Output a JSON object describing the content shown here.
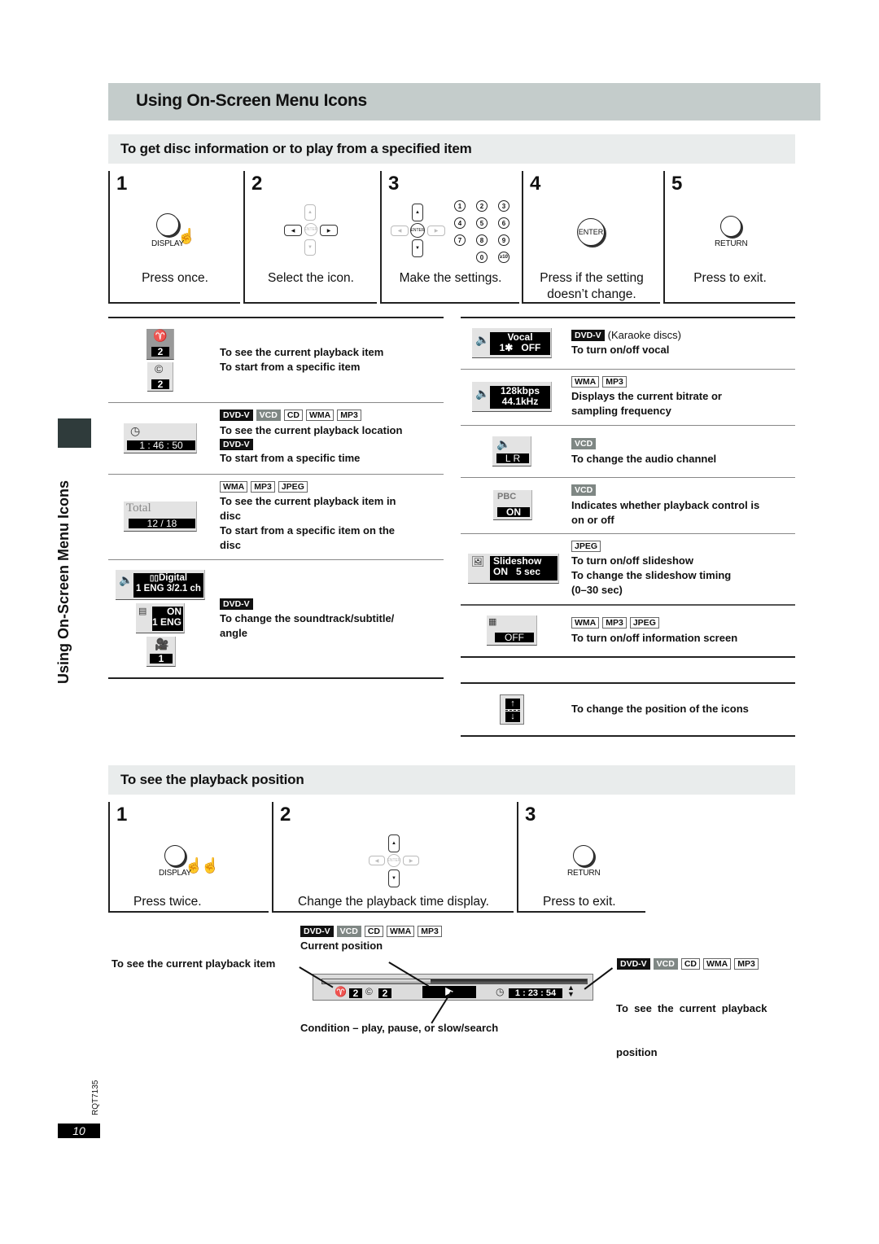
{
  "title": "Using On-Screen Menu Icons",
  "side_label": "Using On-Screen Menu Icons",
  "page_number": "10",
  "doc_code": "RQT7135",
  "section1": {
    "title": "To get disc information or to play from a specified item",
    "steps": [
      {
        "num": "1",
        "button": "DISPLAY",
        "caption": "Press once."
      },
      {
        "num": "2",
        "enter_label": "ENTER",
        "caption": "Select the icon."
      },
      {
        "num": "3",
        "enter_label": "ENTER",
        "caption": "Make the settings.",
        "num_keys": [
          "1",
          "2",
          "3",
          "4",
          "5",
          "6",
          "7",
          "8",
          "9",
          "0",
          "≥10"
        ]
      },
      {
        "num": "4",
        "button": "ENTER",
        "caption_line1": "Press if the setting",
        "caption_line2": "doesn’t change."
      },
      {
        "num": "5",
        "button": "RETURN",
        "caption": "Press to exit."
      }
    ]
  },
  "left_items": [
    {
      "icon": "title-chapter-icon",
      "osd_title_num": "2",
      "osd_chapter_num": "2",
      "badges": [],
      "lines": [
        "To see the current playback item",
        "To start from a specific item"
      ]
    },
    {
      "icon": "clock-icon",
      "osd_text": "1 : 46 : 50",
      "badges": [
        "DVD-V",
        "VCD",
        "CD",
        "WMA",
        "MP3"
      ],
      "line1": "To see the current playback location",
      "badges2": [
        "DVD-V"
      ],
      "line2": "To start from a specific time"
    },
    {
      "icon": "total-icon",
      "osd_label": "Total",
      "osd_text": "12 / 18",
      "badges": [
        "WMA",
        "MP3",
        "JPEG"
      ],
      "lines": [
        "To see the current playback item in",
        "disc",
        "To start from a specific item on the",
        "disc"
      ]
    },
    {
      "icon": "soundtrack-icon",
      "osd_audio_line1": "Digital",
      "osd_audio_line2": "1 ENG 3/2.1 ch",
      "osd_sub_line1": "ON",
      "osd_sub_line2": "1 ENG",
      "osd_angle": "1",
      "badges": [
        "DVD-V"
      ],
      "lines": [
        "To change the soundtrack/subtitle/",
        "angle"
      ]
    }
  ],
  "right_items": [
    {
      "icon": "vocal-icon",
      "osd_line1": "Vocal",
      "osd_line2": "1✱   OFF",
      "badges": [
        "DVD-V"
      ],
      "note": "(Karaoke discs)",
      "lines": [
        "To turn on/off vocal"
      ]
    },
    {
      "icon": "bitrate-icon",
      "osd_line1": "128kbps",
      "osd_line2": "44.1kHz",
      "badges": [
        "WMA",
        "MP3"
      ],
      "lines": [
        "Displays the current bitrate or",
        "sampling frequency"
      ]
    },
    {
      "icon": "audio-channel-icon",
      "osd_text": "L R",
      "badges": [
        "VCD"
      ],
      "lines": [
        "To change the audio channel"
      ]
    },
    {
      "icon": "pbc-icon",
      "osd_label": "PBC",
      "osd_text": "ON",
      "badges": [
        "VCD"
      ],
      "lines": [
        "Indicates whether playback control is",
        "on or off"
      ]
    },
    {
      "icon": "slideshow-icon",
      "osd_line1": "Slideshow",
      "osd_line2": "ON   5 sec",
      "badges": [
        "JPEG"
      ],
      "lines": [
        "To turn on/off slideshow",
        "To change the slideshow timing",
        "(0–30 sec)"
      ]
    },
    {
      "icon": "info-screen-icon",
      "osd_text": "OFF",
      "badges": [
        "WMA",
        "MP3",
        "JPEG"
      ],
      "lines": [
        "To turn on/off information screen"
      ]
    },
    {
      "icon": "position-icon",
      "badges": [],
      "lines": [
        "To change the position of the icons"
      ]
    }
  ],
  "section2": {
    "title": "To see the playback position",
    "steps": [
      {
        "num": "1",
        "button": "DISPLAY",
        "caption": "Press twice."
      },
      {
        "num": "2",
        "enter_label": "ENTER",
        "caption": "Change the playback time display."
      },
      {
        "num": "3",
        "button": "RETURN",
        "caption": "Press to exit."
      }
    ],
    "diagram": {
      "badges_top": [
        "DVD-V",
        "VCD",
        "CD",
        "WMA",
        "MP3"
      ],
      "current_position_label": "Current position",
      "left_label": "To see the current playback item",
      "title_num": "2",
      "chapter_num": "2",
      "play_symbol": "▶",
      "time": "1 : 23 : 54",
      "progress_fraction": 0.41,
      "badges_right": [
        "DVD-V",
        "VCD",
        "CD",
        "WMA",
        "MP3"
      ],
      "right_label_line1": "To  see  the  current  playback",
      "right_label_line2": "position",
      "condition_label": "Condition – play, pause, or slow/search"
    }
  },
  "badge_colors": {
    "DVD-V": "#111111",
    "VCD": "#7f8784"
  }
}
